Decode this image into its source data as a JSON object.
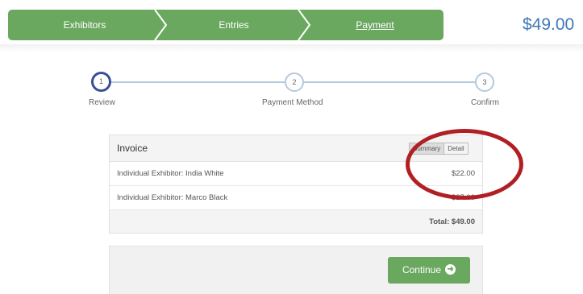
{
  "breadcrumb": {
    "items": [
      {
        "label": "Exhibitors"
      },
      {
        "label": "Entries"
      },
      {
        "label": "Payment"
      }
    ]
  },
  "header": {
    "total": "$49.00"
  },
  "steps": [
    {
      "number": "1",
      "label": "Review",
      "active": true
    },
    {
      "number": "2",
      "label": "Payment Method",
      "active": false
    },
    {
      "number": "3",
      "label": "Confirm",
      "active": false
    }
  ],
  "invoice": {
    "title": "Invoice",
    "view_summary": "Summary",
    "view_detail": "Detail",
    "items": [
      {
        "name": "Individual Exhibitor: India White",
        "amount": "$22.00"
      },
      {
        "name": "Individual Exhibitor: Marco Black",
        "amount": "$27.00"
      }
    ],
    "total": "Total: $49.00"
  },
  "actions": {
    "continue_label": "Continue"
  },
  "colors": {
    "accent": "#6aa85f",
    "total_text": "#3f78b8",
    "highlight": "#b01f24",
    "step_active": "#3a4f97"
  }
}
